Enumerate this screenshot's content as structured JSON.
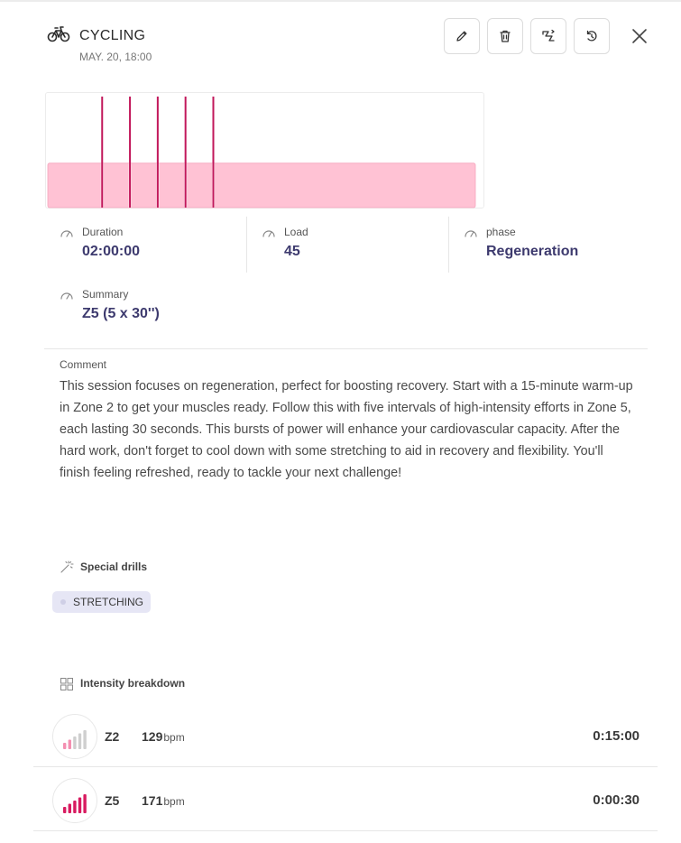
{
  "header": {
    "title": "CYCLING",
    "date": "MAY. 20, 18:00",
    "sport_icon": "bike-icon"
  },
  "toolbar": {
    "buttons": [
      {
        "icon": "pencil-icon"
      },
      {
        "icon": "trash-icon"
      },
      {
        "icon": "route-icon"
      },
      {
        "icon": "undo-icon"
      }
    ],
    "close_icon": "close-icon"
  },
  "chart_data": {
    "type": "bar",
    "xlim": [
      0,
      120
    ],
    "ylim": [
      0,
      5
    ],
    "blocks": [
      {
        "zone": 2,
        "start": 0,
        "end": 120
      }
    ],
    "spikes": [
      {
        "zone": 5,
        "start": 15.0,
        "duration": 0.5
      },
      {
        "zone": 5,
        "start": 22.8,
        "duration": 0.5
      },
      {
        "zone": 5,
        "start": 30.6,
        "duration": 0.5
      },
      {
        "zone": 5,
        "start": 38.4,
        "duration": 0.5
      },
      {
        "zone": 5,
        "start": 46.2,
        "duration": 0.5
      }
    ],
    "colors": {
      "block": "#ffc2d4",
      "block_border": "#f5a5bd",
      "spike": "#c2185b"
    }
  },
  "metrics": {
    "duration": {
      "label": "Duration",
      "value": "02:00:00"
    },
    "load": {
      "label": "Load",
      "value": "45"
    },
    "phase": {
      "label": "phase",
      "value": "Regeneration"
    },
    "summary": {
      "label": "Summary",
      "value": "Z5 (5 x 30'')"
    }
  },
  "comment": {
    "label": "Comment",
    "text": "This session focuses on regeneration, perfect for boosting recovery. Start with a 15-minute warm-up in Zone 2 to get your muscles ready. Follow this with five intervals of high-intensity efforts in Zone 5, each lasting 30 seconds. This bursts of power will enhance your cardiovascular capacity. After the hard work, don't forget to cool down with some stretching to aid in recovery and flexibility. You'll finish feeling refreshed, ready to tackle your next challenge!"
  },
  "drills": {
    "title": "Special drills",
    "items": [
      "STRETCHING"
    ]
  },
  "intensity": {
    "title": "Intensity breakdown",
    "rows": [
      {
        "zone": "Z2",
        "level": 2,
        "bpm": "129",
        "unit": "bpm",
        "time": "0:15:00"
      },
      {
        "zone": "Z5",
        "level": 5,
        "bpm": "171",
        "unit": "bpm",
        "time": "0:00:30"
      }
    ]
  },
  "colors": {
    "accent": "#3d3a6e",
    "zone_active": "#d81b60",
    "zone_light": "#f48fb1",
    "zone_inactive": "#cfcfcf",
    "chip_bg": "#e6e6f5"
  }
}
